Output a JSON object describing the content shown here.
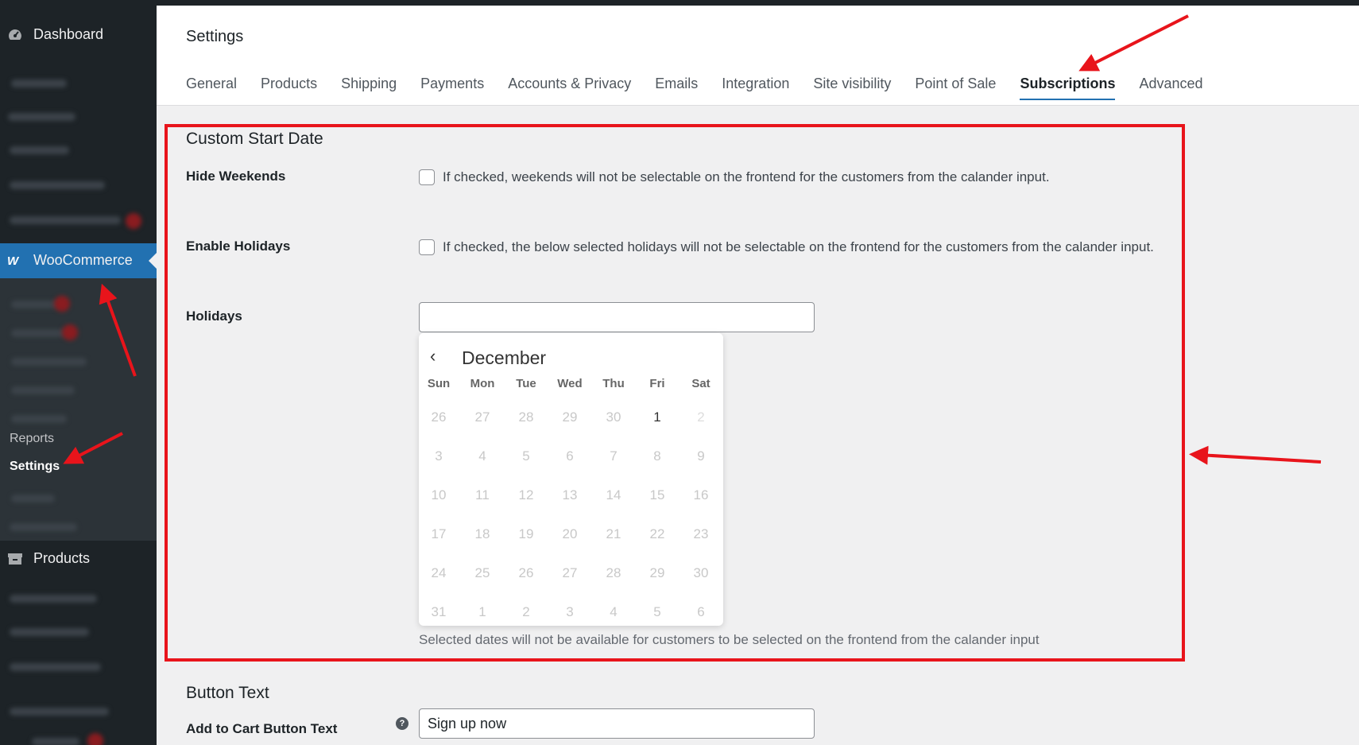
{
  "sidebar": {
    "dashboard_label": "Dashboard",
    "woocommerce_label": "WooCommerce",
    "reports_label": "Reports",
    "settings_label": "Settings",
    "products_label": "Products"
  },
  "header": {
    "title": "Settings",
    "tabs": [
      "General",
      "Products",
      "Shipping",
      "Payments",
      "Accounts & Privacy",
      "Emails",
      "Integration",
      "Site visibility",
      "Point of Sale",
      "Subscriptions",
      "Advanced"
    ],
    "active_tab": "Subscriptions"
  },
  "custom_start_date": {
    "title": "Custom Start Date",
    "hide_weekends": {
      "label": "Hide Weekends",
      "description": "If checked, weekends will not be selectable on the frontend for the customers from the calander input.",
      "checked": false
    },
    "enable_holidays": {
      "label": "Enable Holidays",
      "description": "If checked, the below selected holidays will not be selectable on the frontend for the customers from the calander input.",
      "checked": false
    },
    "holidays": {
      "label": "Holidays",
      "value": "",
      "help": "Selected dates will not be available for customers to be selected on the frontend from the calander input"
    }
  },
  "calendar": {
    "month": "December",
    "weekdays": [
      "Sun",
      "Mon",
      "Tue",
      "Wed",
      "Thu",
      "Fri",
      "Sat"
    ],
    "weeks": [
      [
        "26",
        "27",
        "28",
        "29",
        "30",
        "1",
        "2"
      ],
      [
        "3",
        "4",
        "5",
        "6",
        "7",
        "8",
        "9"
      ],
      [
        "10",
        "11",
        "12",
        "13",
        "14",
        "15",
        "16"
      ],
      [
        "17",
        "18",
        "19",
        "20",
        "21",
        "22",
        "23"
      ],
      [
        "24",
        "25",
        "26",
        "27",
        "28",
        "29",
        "30"
      ],
      [
        "31",
        "1",
        "2",
        "3",
        "4",
        "5",
        "6"
      ]
    ],
    "enabled_day": "1"
  },
  "button_text": {
    "title": "Button Text",
    "add_to_cart_label": "Add to Cart Button Text",
    "add_to_cart_value": "Sign up now",
    "help_icon_glyph": "?"
  },
  "colors": {
    "sidebar_bg": "#1d2327",
    "accent": "#2271b1",
    "annotation": "#e8141b"
  }
}
